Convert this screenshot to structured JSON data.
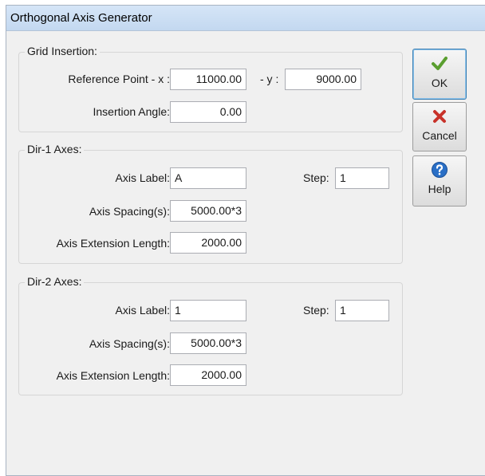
{
  "window": {
    "title": "Orthogonal Axis Generator"
  },
  "grid_insertion": {
    "legend": "Grid Insertion:",
    "ref_point_label": "Reference Point - x :",
    "x_value": "11000.00",
    "y_label": "- y :",
    "y_value": "9000.00",
    "angle_label": "Insertion Angle:",
    "angle_value": "0.00"
  },
  "dir1": {
    "legend": "Dir-1 Axes:",
    "axis_label_label": "Axis Label:",
    "axis_label_value": "A",
    "step_label": "Step:",
    "step_value": "1",
    "spacing_label": "Axis Spacing(s):",
    "spacing_value": "5000.00*3",
    "extension_label": "Axis Extension Length:",
    "extension_value": "2000.00"
  },
  "dir2": {
    "legend": "Dir-2 Axes:",
    "axis_label_label": "Axis Label:",
    "axis_label_value": "1",
    "step_label": "Step:",
    "step_value": "1",
    "spacing_label": "Axis Spacing(s):",
    "spacing_value": "5000.00*3",
    "extension_label": "Axis Extension Length:",
    "extension_value": "2000.00"
  },
  "buttons": {
    "ok_label": "OK",
    "cancel_label": "Cancel",
    "help_label": "Help"
  },
  "icons": {
    "ok": "checkmark-icon",
    "cancel": "red-x-icon",
    "help": "question-mark-icon"
  },
  "colors": {
    "title_bar": "#c9dcf2",
    "dialog_bg": "#f0f0f0",
    "ok_check": "#5a9e2f",
    "cancel_x": "#c8322a",
    "help_circle": "#2a6fc6"
  }
}
